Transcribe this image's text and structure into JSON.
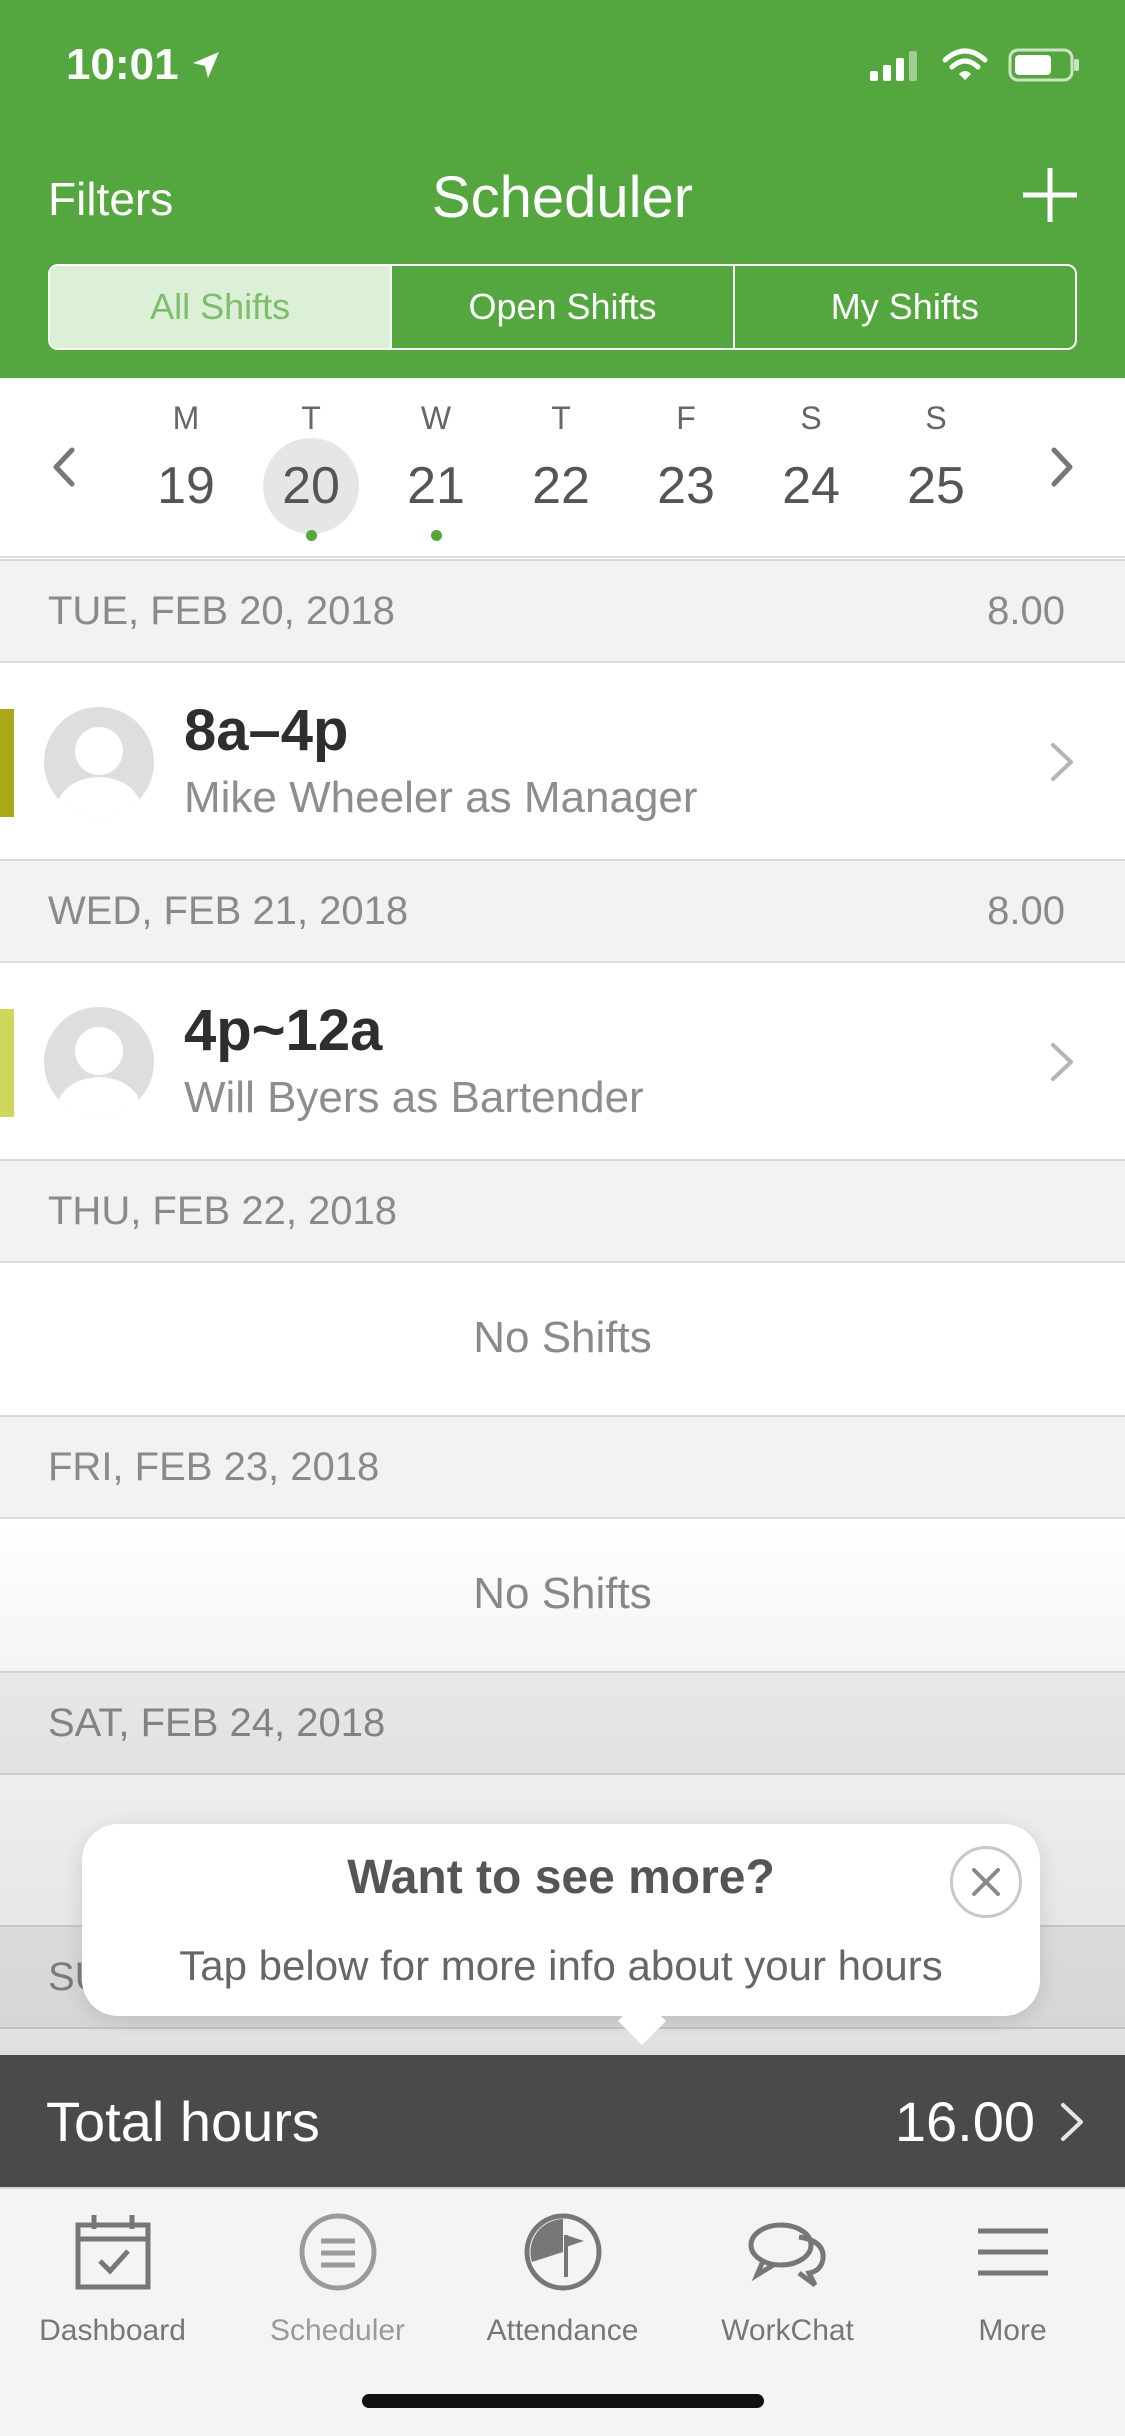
{
  "status_bar": {
    "time": "10:01"
  },
  "nav": {
    "left": "Filters",
    "title": "Scheduler",
    "add_icon": "plus-icon"
  },
  "segments": [
    {
      "label": "All Shifts",
      "selected": true
    },
    {
      "label": "Open Shifts",
      "selected": false
    },
    {
      "label": "My Shifts",
      "selected": false
    }
  ],
  "week": {
    "days": [
      {
        "letter": "M",
        "num": "19",
        "selected": false,
        "dot": false
      },
      {
        "letter": "T",
        "num": "20",
        "selected": true,
        "dot": true
      },
      {
        "letter": "W",
        "num": "21",
        "selected": false,
        "dot": true
      },
      {
        "letter": "T",
        "num": "22",
        "selected": false,
        "dot": false
      },
      {
        "letter": "F",
        "num": "23",
        "selected": false,
        "dot": false
      },
      {
        "letter": "S",
        "num": "24",
        "selected": false,
        "dot": false
      },
      {
        "letter": "S",
        "num": "25",
        "selected": false,
        "dot": false
      }
    ]
  },
  "sections": [
    {
      "date": "TUE, FEB 20, 2018",
      "hours": "8.00"
    },
    {
      "date": "WED, FEB 21, 2018",
      "hours": "8.00"
    },
    {
      "date": "THU, FEB 22, 2018",
      "hours": ""
    },
    {
      "date": "FRI, FEB 23, 2018",
      "hours": ""
    },
    {
      "date": "SAT, FEB 24, 2018",
      "hours": ""
    },
    {
      "date": "SU",
      "hours": ""
    }
  ],
  "shifts": [
    {
      "time": "8a–4p",
      "person": "Mike Wheeler as Manager",
      "color": "#a8a818"
    },
    {
      "time": "4p~12a",
      "person": "Will Byers as Bartender",
      "color": "#cfd65c"
    }
  ],
  "empty_text": "No Shifts",
  "tooltip": {
    "title": "Want to see more?",
    "body": "Tap below for more info about your hours"
  },
  "total": {
    "label": "Total hours",
    "value": "16.00"
  },
  "tabs": [
    {
      "label": "Dashboard",
      "icon": "calendar-check-icon"
    },
    {
      "label": "Scheduler",
      "icon": "list-circle-icon",
      "active": true
    },
    {
      "label": "Attendance",
      "icon": "clock-flag-icon"
    },
    {
      "label": "WorkChat",
      "icon": "chat-bubbles-icon"
    },
    {
      "label": "More",
      "icon": "hamburger-menu-icon"
    }
  ],
  "colors": {
    "brand_green": "#54a63e",
    "segment_selected_bg": "#dcefd7",
    "total_bar": "#4a4a4a"
  }
}
